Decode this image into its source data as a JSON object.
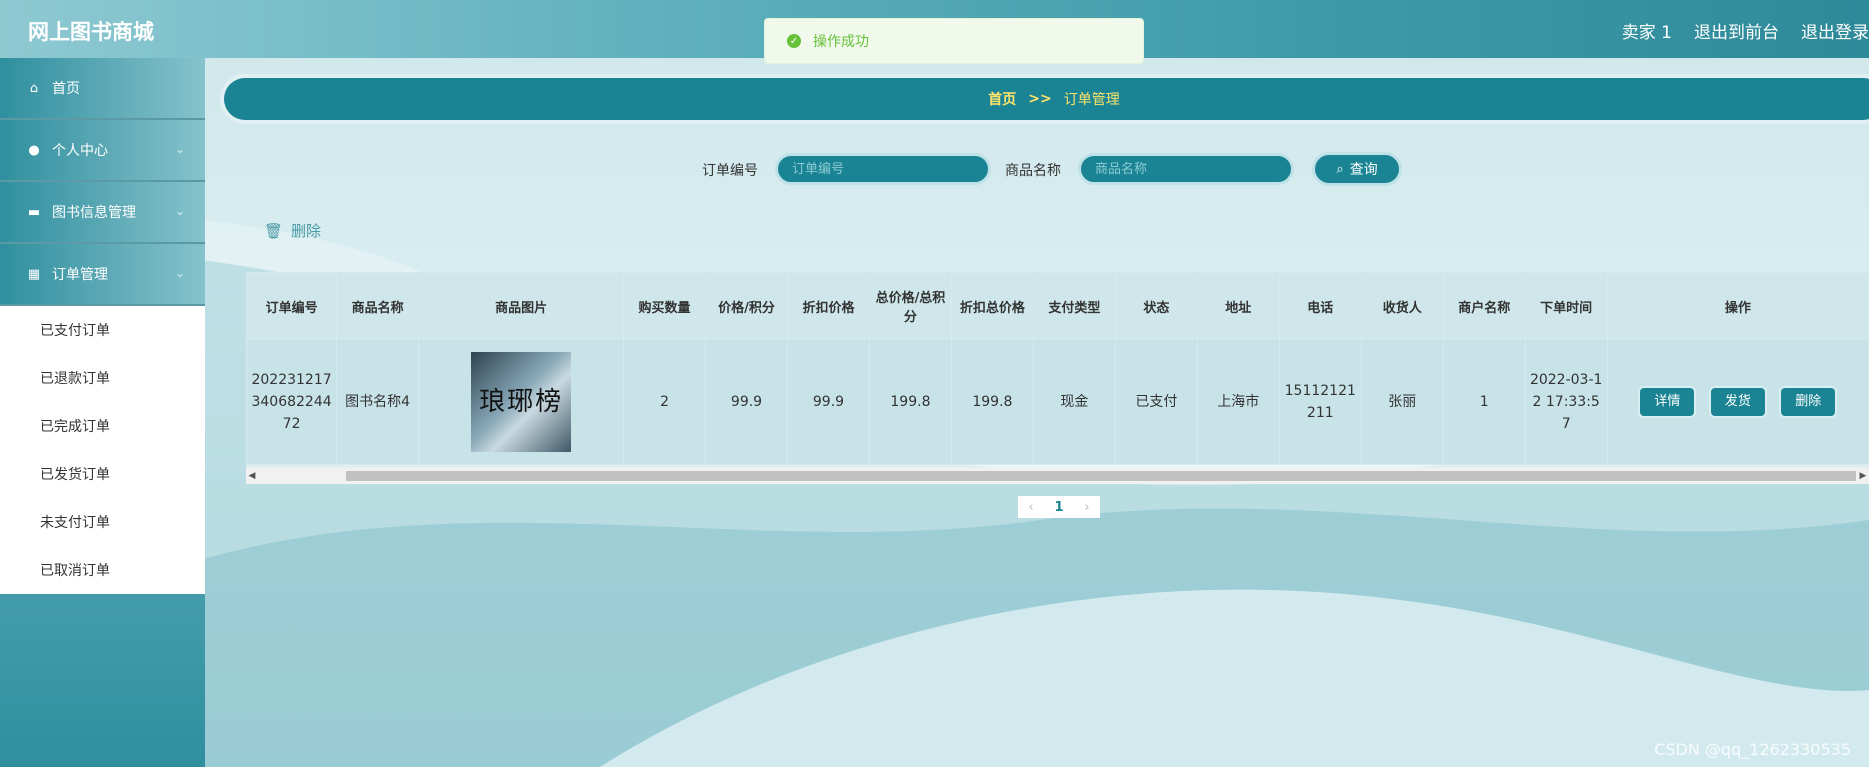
{
  "app": {
    "title": "网上图书商城"
  },
  "header": {
    "user": "卖家 1",
    "to_front": "退出到前台",
    "logout": "退出登录"
  },
  "toast": {
    "message": "操作成功"
  },
  "sidebar": {
    "items": [
      {
        "label": "首页",
        "icon": "home-icon"
      },
      {
        "label": "个人中心",
        "icon": "user-icon"
      },
      {
        "label": "图书信息管理",
        "icon": "briefcase-icon"
      },
      {
        "label": "订单管理",
        "icon": "grid-icon"
      }
    ],
    "submenu": [
      "已支付订单",
      "已退款订单",
      "已完成订单",
      "已发货订单",
      "未支付订单",
      "已取消订单"
    ]
  },
  "breadcrumb": {
    "home": "首页",
    "sep": ">>",
    "current": "订单管理"
  },
  "search": {
    "order_label": "订单编号",
    "order_placeholder": "订单编号",
    "product_label": "商品名称",
    "product_placeholder": "商品名称",
    "query_label": "查询"
  },
  "toolbar": {
    "delete_label": "删除"
  },
  "table": {
    "headers": [
      "订单编号",
      "商品名称",
      "商品图片",
      "购买数量",
      "价格/积分",
      "折扣价格",
      "总价格/总积分",
      "折扣总价格",
      "支付类型",
      "状态",
      "地址",
      "电话",
      "收货人",
      "商户名称",
      "下单时间",
      "操作"
    ],
    "rows": [
      {
        "order_no": "20223121734068224472",
        "product": "图书名称4",
        "image_text": "琅琊榜",
        "quantity": "2",
        "price": "99.9",
        "discount_price": "99.9",
        "total": "199.8",
        "discount_total": "199.8",
        "pay_type": "现金",
        "status": "已支付",
        "address": "上海市",
        "phone": "15112121211",
        "receiver": "张丽",
        "merchant": "1",
        "order_time": "2022-03-12 17:33:57",
        "actions": [
          "详情",
          "发货",
          "删除"
        ]
      }
    ]
  },
  "pager": {
    "current": "1"
  },
  "watermark": "CSDN @qq_1262330535"
}
